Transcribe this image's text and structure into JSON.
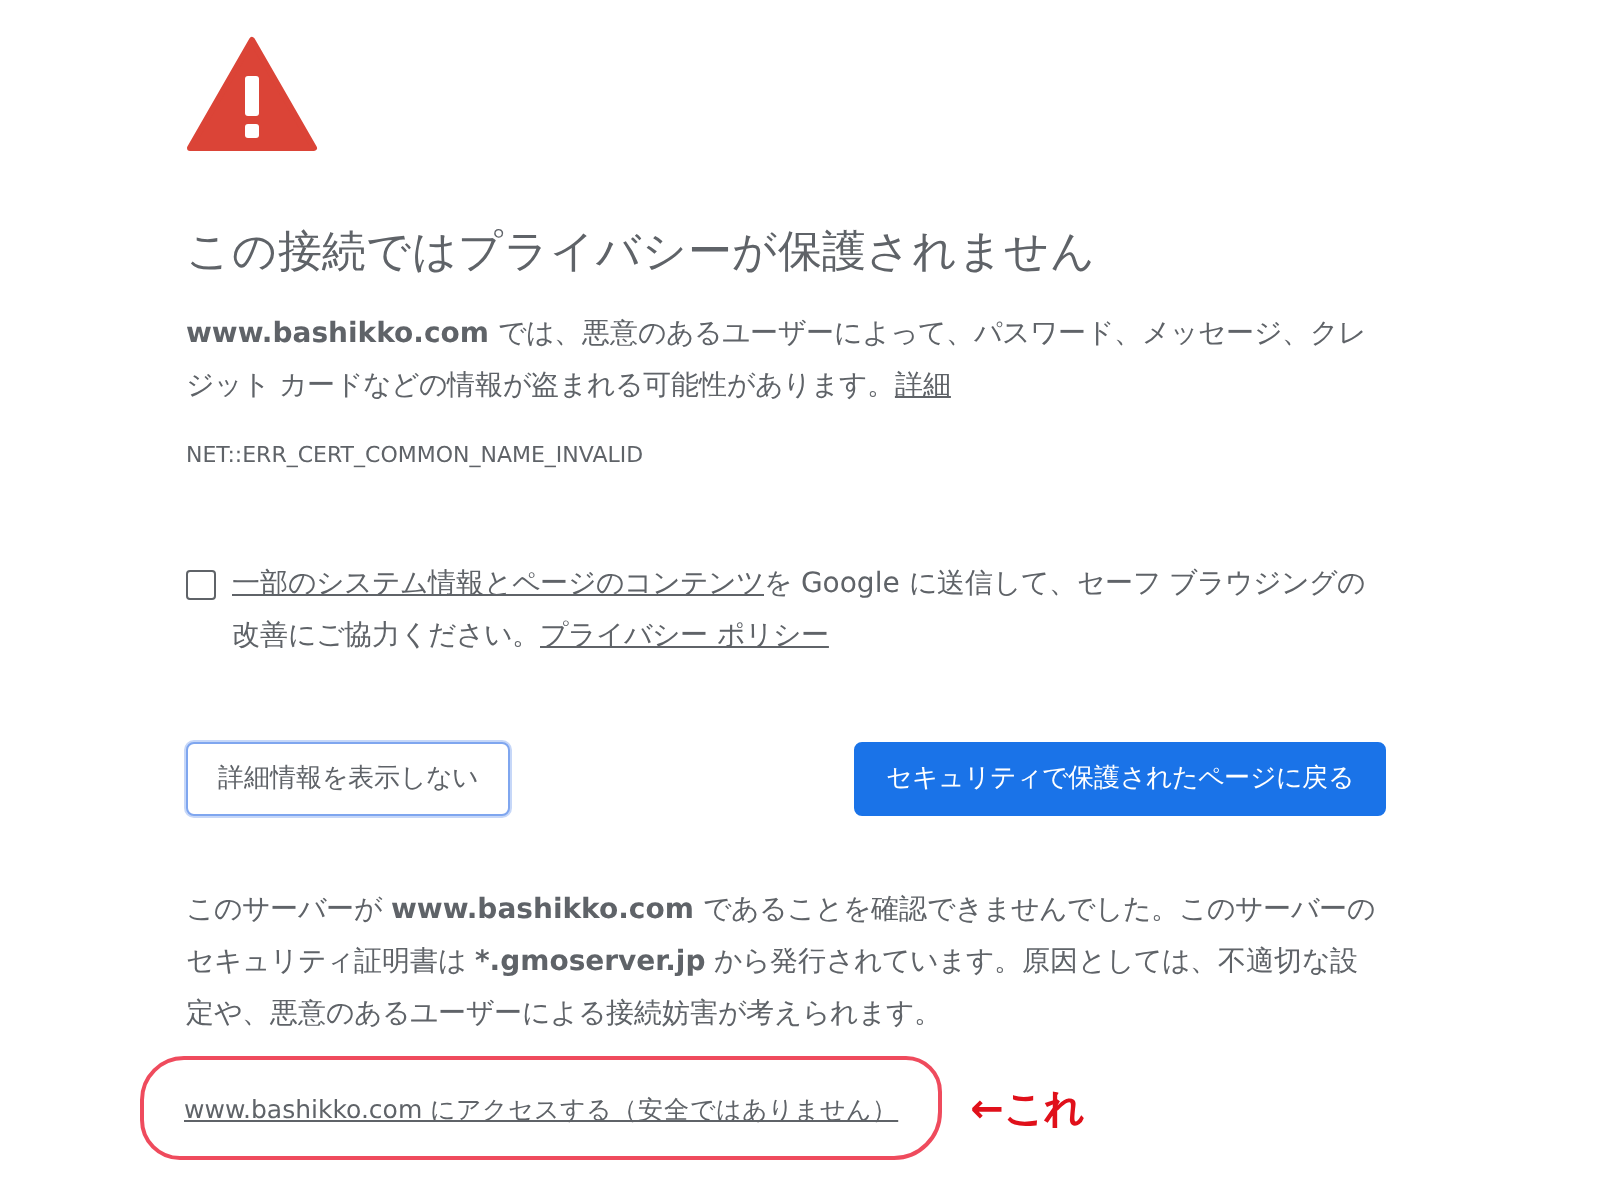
{
  "title": "この接続ではプライバシーが保護されません",
  "description": {
    "text": "**www.bashikko.com** では、悪意のあるユーザーによって、パスワード、メッセージ、クレジット カードなどの情報が盗まれる可能性があります。",
    "link": "詳細"
  },
  "error_code": "NET::ERR_CERT_COMMON_NAME_INVALID",
  "report": {
    "checked": false,
    "link": "一部のシステム情報とページのコンテンツ",
    "text": "を Google に送信して、セーフ ブラウジングの改善にご協力ください。",
    "policy_link": "プライバシー ポリシー"
  },
  "buttons": [
    {
      "label": "詳細情報を表示しない",
      "kind": "secondary"
    },
    {
      "label": "セキュリティで保護されたページに戻る",
      "kind": "primary"
    }
  ],
  "details": "このサーバーが **www.bashikko.com** であることを確認できませんでした。このサーバーのセキュリティ証明書は ***.gmoserver.jp** から発行されています。原因としては、不適切な設定や、悪意のあるユーザーによる接続妨害が考えられます。",
  "proceed_link": "www.bashikko.com にアクセスする（安全ではありません）",
  "annotation": "←これ"
}
